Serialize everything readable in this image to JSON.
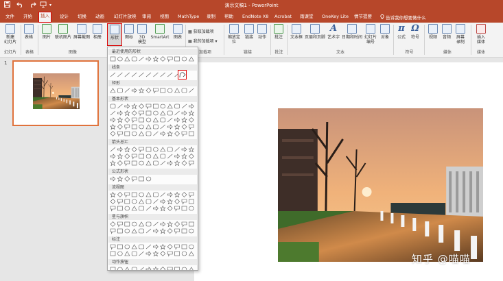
{
  "app": {
    "title": "演示文稿1 - PowerPoint",
    "qa_icons": [
      "save-icon",
      "undo-icon",
      "redo-icon",
      "present-icon"
    ]
  },
  "tabs": [
    {
      "id": "file",
      "label": "文件"
    },
    {
      "id": "home",
      "label": "开始"
    },
    {
      "id": "insert",
      "label": "插入",
      "active": true
    },
    {
      "id": "design",
      "label": "设计"
    },
    {
      "id": "transitions",
      "label": "切换"
    },
    {
      "id": "animations",
      "label": "动画"
    },
    {
      "id": "slideshow",
      "label": "幻灯片放映"
    },
    {
      "id": "review",
      "label": "审阅"
    },
    {
      "id": "view",
      "label": "视图"
    },
    {
      "id": "mathtype",
      "label": "MathType"
    },
    {
      "id": "record",
      "label": "录制"
    },
    {
      "id": "help",
      "label": "帮助"
    },
    {
      "id": "endnote",
      "label": "EndNote X8"
    },
    {
      "id": "acrobat",
      "label": "Acrobat"
    },
    {
      "id": "rain",
      "label": "雨课堂"
    },
    {
      "id": "onekey",
      "label": "OneKey Lite"
    },
    {
      "id": "emotion",
      "label": "情节提要"
    }
  ],
  "tell_me": "告诉我你想要做什么",
  "ribbon": {
    "new_slide": "新建\n幻灯片",
    "table": "表格",
    "picture": "图片",
    "online_picture": "联机图片",
    "screenshot": "屏幕截图",
    "album": "相册",
    "shapes": "形状",
    "icons": "图标",
    "model3d": "3D\n模型",
    "smartart": "SmartArt",
    "chart": "图表",
    "get_addins": "获取加载项",
    "my_addins": "我的加载项",
    "zoom": "缩放定\n位",
    "link": "链接",
    "action": "动作",
    "comment": "批注",
    "textbox": "文本框",
    "header_footer": "页眉和页脚",
    "wordart": "艺术字",
    "datetime": "日期和时间",
    "slide_number": "幻灯片\n编号",
    "object": "对象",
    "equation": "公式",
    "symbol": "符号",
    "video": "视频",
    "audio": "音频",
    "screen_record": "屏幕\n录制",
    "insert_media": "插入\n媒体"
  },
  "ribbon_groups": {
    "slides": "幻灯片",
    "tables": "表格",
    "images": "图像",
    "addins": "加载项",
    "links": "链接",
    "comments": "批注",
    "text": "文本",
    "symbols": "符号",
    "media": "媒体",
    "media2": "媒体"
  },
  "shapes_menu": {
    "sections": [
      "最近使用的形状",
      "线条",
      "矩形",
      "基本形状",
      "箭头总汇",
      "公式形状",
      "流程图",
      "星与旗帜",
      "标注",
      "动作按钮"
    ]
  },
  "slides": {
    "current_number": "1"
  },
  "watermark": "知乎 @喵喵",
  "colors": {
    "brand": "#b7472a",
    "highlight": "#dd0000",
    "selection": "#e0723b"
  }
}
